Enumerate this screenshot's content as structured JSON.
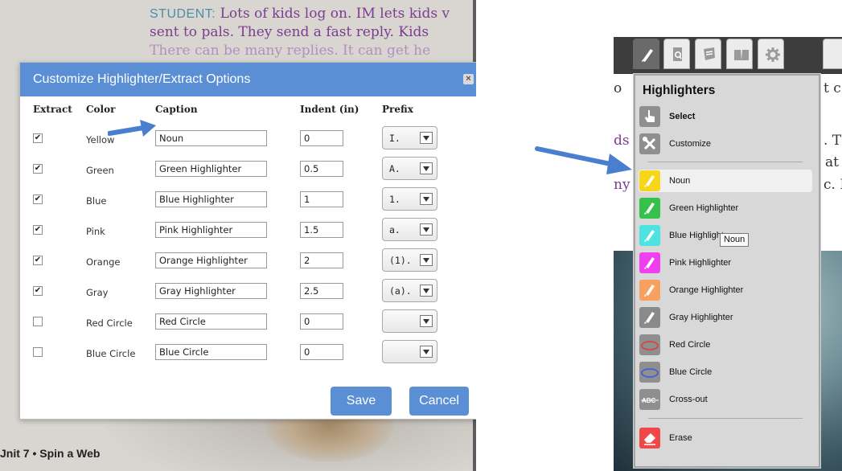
{
  "left": {
    "story": {
      "speaker": "STUDENT:",
      "line1": " Lots of kids log on. IM lets kids v",
      "line2": "sent to pals. They send a fast reply. Kids",
      "line3": "There can be many replies. It can get he"
    },
    "footer": "Jnit 7 • Spin a Web",
    "dialog": {
      "title": "Customize Highlighter/Extract Options",
      "close": "×",
      "headers": {
        "extract": "Extract",
        "color": "Color",
        "caption": "Caption",
        "indent": "Indent (in)",
        "prefix": "Prefix"
      },
      "rows": [
        {
          "checked": "✔",
          "color": "Yellow",
          "caption": "Noun",
          "indent": "0",
          "prefix": "I."
        },
        {
          "checked": "✔",
          "color": "Green",
          "caption": "Green Highlighter",
          "indent": "0.5",
          "prefix": "A."
        },
        {
          "checked": "✔",
          "color": "Blue",
          "caption": "Blue Highlighter",
          "indent": "1",
          "prefix": "1."
        },
        {
          "checked": "✔",
          "color": "Pink",
          "caption": "Pink Highlighter",
          "indent": "1.5",
          "prefix": "a."
        },
        {
          "checked": "✔",
          "color": "Orange",
          "caption": "Orange Highlighter",
          "indent": "2",
          "prefix": "(1)."
        },
        {
          "checked": "✔",
          "color": "Gray",
          "caption": "Gray Highlighter",
          "indent": "2.5",
          "prefix": "(a)."
        },
        {
          "checked": "",
          "color": "Red Circle",
          "caption": "Red Circle",
          "indent": "0",
          "prefix": ""
        },
        {
          "checked": "",
          "color": "Blue Circle",
          "caption": "Blue Circle",
          "indent": "0",
          "prefix": ""
        }
      ],
      "save": "Save",
      "cancel": "Cancel"
    }
  },
  "right": {
    "bg_text": {
      "a": "o",
      "b": "t c",
      "c": "ds",
      "d": ". T",
      "e": "at",
      "f": "ny",
      "g": "c. I"
    },
    "toolbar_icons": [
      "highlighter-pen-icon",
      "document-search-icon",
      "notes-icon",
      "book-icon",
      "settings-gear-icon"
    ],
    "panel": {
      "title": "Highlighters",
      "items": [
        {
          "label": "Select",
          "icon": "hand-pointer-icon",
          "color": "#8f8f8f",
          "bold": true
        },
        {
          "label": "Customize",
          "icon": "customize-tools-icon",
          "color": "#8f8f8f",
          "bold": false
        },
        {
          "label": "Noun",
          "icon": "yellow-highlighter-icon",
          "color": "#f7d61a",
          "bold": false
        },
        {
          "label": "Green Highlighter",
          "icon": "green-highlighter-icon",
          "color": "#36c24a",
          "bold": false
        },
        {
          "label": "Blue Highlighter",
          "icon": "blue-highlighter-icon",
          "color": "#4de3e3",
          "bold": false
        },
        {
          "label": "Pink Highlighter",
          "icon": "pink-highlighter-icon",
          "color": "#f03ff0",
          "bold": false
        },
        {
          "label": "Orange Highlighter",
          "icon": "orange-highlighter-icon",
          "color": "#f7a060",
          "bold": false
        },
        {
          "label": "Gray Highlighter",
          "icon": "gray-highlighter-icon",
          "color": "#8a8a8a",
          "bold": false
        },
        {
          "label": "Red Circle",
          "icon": "red-circle-icon",
          "color": "#8f8f8f",
          "bold": false
        },
        {
          "label": "Blue Circle",
          "icon": "blue-circle-icon",
          "color": "#8f8f8f",
          "bold": false
        },
        {
          "label": "Cross-out",
          "icon": "cross-out-icon",
          "color": "#8f8f8f",
          "bold": false
        },
        {
          "label": "Erase",
          "icon": "eraser-icon",
          "color": "#f04848",
          "bold": false
        }
      ],
      "tooltip": "Noun"
    }
  },
  "colors": {
    "accent": "#5a8fd6",
    "arrow": "#4a7fd0"
  }
}
